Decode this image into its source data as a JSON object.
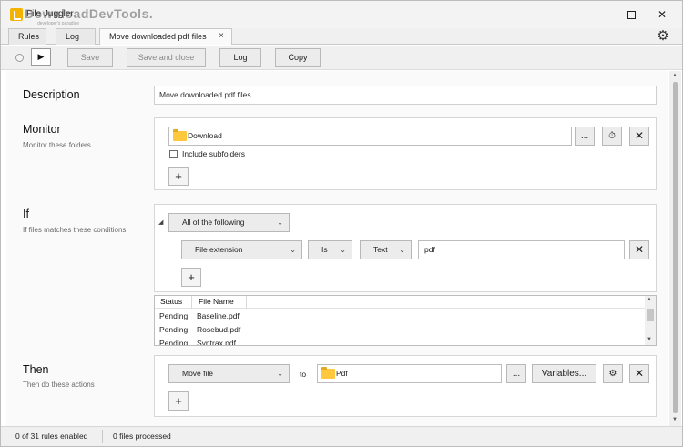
{
  "window": {
    "title": "File Juggler",
    "watermark": "DownloadDevTools.",
    "watermark_sub": "developer's paradise"
  },
  "tabs": [
    {
      "label": "Rules"
    },
    {
      "label": "Log"
    },
    {
      "label": "Move downloaded pdf files",
      "close": "×"
    }
  ],
  "toolbar": {
    "play_glyph": "▶",
    "save_label": "Save",
    "save_close_label": "Save and close",
    "log_label": "Log",
    "copy_label": "Copy"
  },
  "description": {
    "title": "Description",
    "value": "Move downloaded pdf files"
  },
  "monitor": {
    "title": "Monitor",
    "subtitle": "Monitor these folders",
    "folder": "Download",
    "browse_label": "...",
    "include_subfolders_label": "Include subfolders",
    "include_subfolders_checked": false,
    "add_label": "+"
  },
  "if": {
    "title": "If",
    "subtitle": "If files matches these conditions",
    "match_mode": "All of the following",
    "condition": {
      "field": "File extension",
      "operator": "Is",
      "type": "Text",
      "value": "pdf"
    },
    "add_label": "+"
  },
  "file_list": {
    "columns": [
      "Status",
      "File Name"
    ],
    "rows": [
      {
        "status": "Pending",
        "name": "Baseline.pdf"
      },
      {
        "status": "Pending",
        "name": "Rosebud.pdf"
      },
      {
        "status": "Pending",
        "name": "Syntrax.pdf"
      }
    ]
  },
  "then": {
    "title": "Then",
    "subtitle": "Then do these actions",
    "action": "Move file",
    "to_label": "to",
    "destination": "Pdf",
    "browse_label": "...",
    "variables_label": "Variables...",
    "add_label": "+"
  },
  "statusbar": {
    "rules_enabled": "0 of 31 rules enabled",
    "files_processed": "0 files processed"
  },
  "colors": {
    "folder": "#ffc83d",
    "app_icon": "#f5b301"
  }
}
